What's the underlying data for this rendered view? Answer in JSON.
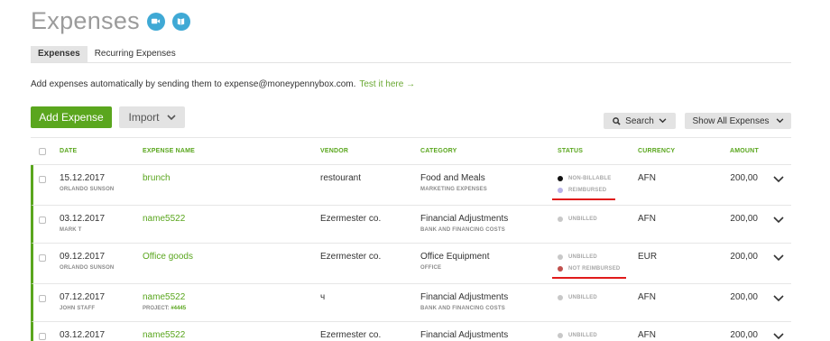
{
  "page": {
    "title": "Expenses",
    "video_icon": "video-camera-icon",
    "help_icon": "book-icon"
  },
  "tabs": [
    {
      "label": "Expenses",
      "active": true
    },
    {
      "label": "Recurring Expenses",
      "active": false
    }
  ],
  "info": {
    "text": "Add expenses automatically by sending them to expense@moneypennybox.com.",
    "link": "Test it here →"
  },
  "toolbar": {
    "add_label": "Add Expense",
    "import_label": "Import",
    "search_label": "Search",
    "filter_label": "Show All Expenses"
  },
  "columns": [
    "DATE",
    "EXPENSE NAME",
    "VENDOR",
    "CATEGORY",
    "STATUS",
    "CURRENCY",
    "AMOUNT"
  ],
  "rows": [
    {
      "date": "15.12.2017",
      "user": "ORLANDO SUNSON",
      "name": "brunch",
      "project_label": "",
      "project": "",
      "vendor": "restourant",
      "category": "Food and Meals",
      "subcategory": "MARKETING EXPENSES",
      "statuses": [
        {
          "label": "NON-BILLABLE",
          "color": "#111111"
        },
        {
          "label": "REIMBURSED",
          "color": "#b9b4e8"
        }
      ],
      "currency": "AFN",
      "amount": "200,00"
    },
    {
      "date": "03.12.2017",
      "user": "MARK T",
      "name": "name5522",
      "project_label": "",
      "project": "",
      "vendor": "Ezermester co.",
      "category": "Financial Adjustments",
      "subcategory": "BANK AND FINANCING COSTS",
      "statuses": [
        {
          "label": "UNBILLED",
          "color": "#c8c8c8"
        }
      ],
      "currency": "AFN",
      "amount": "200,00"
    },
    {
      "date": "09.12.2017",
      "user": "ORLANDO SUNSON",
      "name": "Office goods",
      "project_label": "",
      "project": "",
      "vendor": "Ezermester co.",
      "category": "Office Equipment",
      "subcategory": "OFFICE",
      "statuses": [
        {
          "label": "UNBILLED",
          "color": "#c8c8c8"
        },
        {
          "label": "NOT REIMBURSED",
          "color": "#c0504d"
        }
      ],
      "currency": "EUR",
      "amount": "200,00"
    },
    {
      "date": "07.12.2017",
      "user": "JOHN STAFF",
      "name": "name5522",
      "project_label": "PROJECT:",
      "project": "#4445",
      "vendor": "ч",
      "category": "Financial Adjustments",
      "subcategory": "BANK AND FINANCING COSTS",
      "statuses": [
        {
          "label": "UNBILLED",
          "color": "#c8c8c8"
        }
      ],
      "currency": "AFN",
      "amount": "200,00"
    },
    {
      "date": "03.12.2017",
      "user": "",
      "name": "name5522",
      "project_label": "",
      "project": "",
      "vendor": "Ezermester co.",
      "category": "Financial Adjustments",
      "subcategory": "",
      "statuses": [
        {
          "label": "UNBILLED",
          "color": "#c8c8c8"
        }
      ],
      "currency": "AFN",
      "amount": "200,00"
    }
  ]
}
